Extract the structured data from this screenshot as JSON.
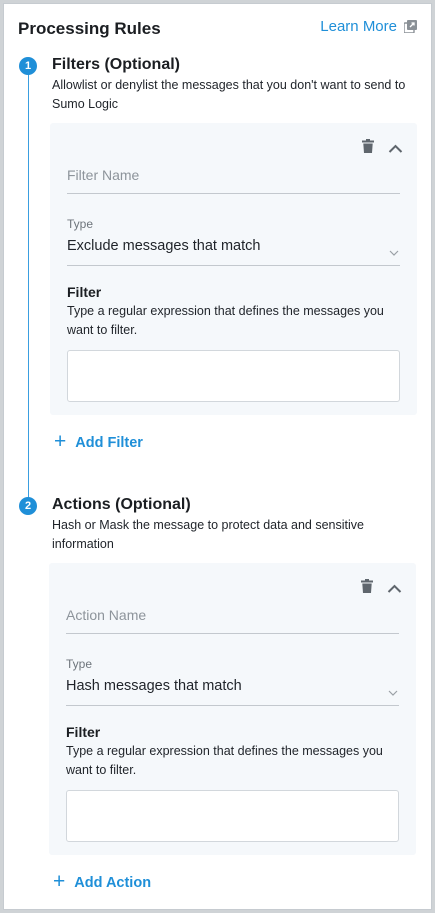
{
  "header": {
    "title": "Processing Rules",
    "learn_more_label": "Learn More"
  },
  "colors": {
    "accent": "#1f8fd8",
    "card_bg": "#f5f8fb",
    "icon_gray": "#5f666d"
  },
  "sections": [
    {
      "step": "1",
      "title": "Filters (Optional)",
      "description": "Allowlist or denylist the messages that you don't want to send to Sumo Logic",
      "card": {
        "name_placeholder": "Filter Name",
        "type_label": "Type",
        "type_value": "Exclude messages that match",
        "filter_label": "Filter",
        "filter_help": "Type a regular expression that defines the messages you want to filter.",
        "filter_value": "",
        "icons": [
          "trash-icon",
          "chevron-up-icon"
        ]
      },
      "add_label": "Add Filter"
    },
    {
      "step": "2",
      "title": "Actions (Optional)",
      "description": "Hash or Mask the message to protect data and sensitive information",
      "card": {
        "name_placeholder": "Action Name",
        "type_label": "Type",
        "type_value": "Hash messages that match",
        "filter_label": "Filter",
        "filter_help": "Type a regular expression that defines the messages you want to filter.",
        "filter_value": "",
        "icons": [
          "trash-icon",
          "chevron-up-icon"
        ]
      },
      "add_label": "Add Action"
    }
  ]
}
